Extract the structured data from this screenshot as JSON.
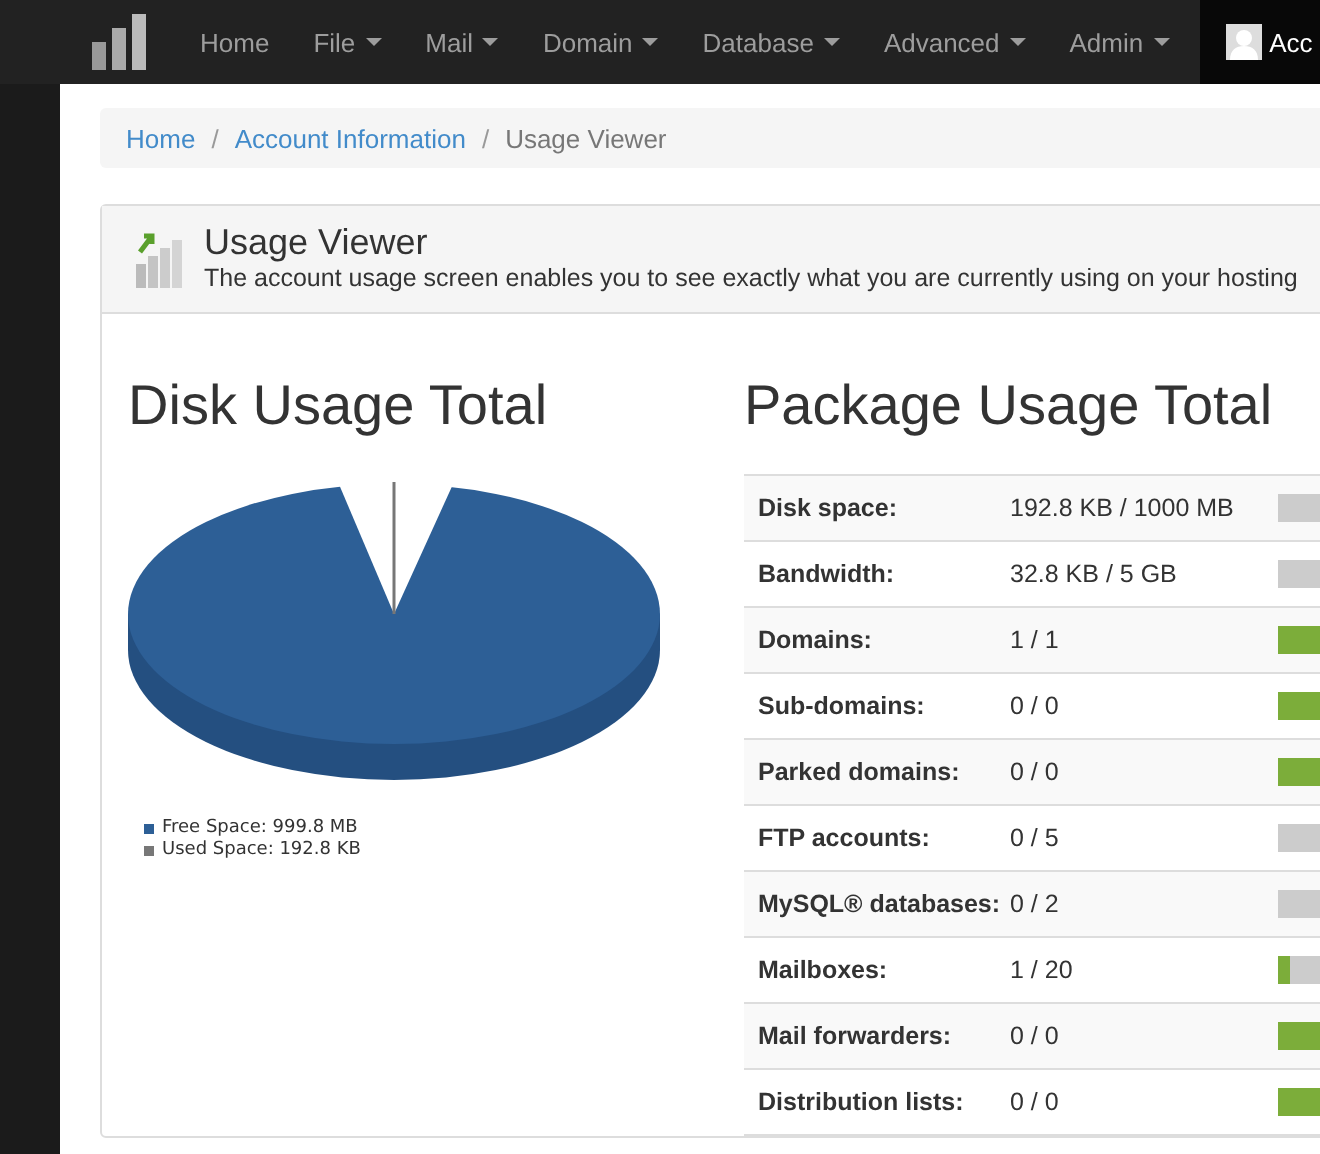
{
  "navbar": {
    "items": [
      {
        "label": "Home",
        "dropdown": false
      },
      {
        "label": "File",
        "dropdown": true
      },
      {
        "label": "Mail",
        "dropdown": true
      },
      {
        "label": "Domain",
        "dropdown": true
      },
      {
        "label": "Database",
        "dropdown": true
      },
      {
        "label": "Advanced",
        "dropdown": true
      },
      {
        "label": "Admin",
        "dropdown": true
      }
    ],
    "user": "Acc"
  },
  "breadcrumb": [
    {
      "label": "Home",
      "link": true
    },
    {
      "separator": "/",
      "label": "Account Information",
      "link": true
    },
    {
      "separator": "/",
      "label": "Usage Viewer",
      "link": false
    }
  ],
  "panel": {
    "title": "Usage Viewer",
    "description": "The account usage screen enables you to see exactly what you are currently using on your hosting"
  },
  "disk_usage": {
    "heading": "Disk Usage Total",
    "legend": [
      {
        "label": "Free Space: 999.8 MB",
        "color": "#2d5f96"
      },
      {
        "label": "Used Space: 192.8 KB",
        "color": "#777777"
      }
    ]
  },
  "package_usage": {
    "heading": "Package Usage Total",
    "rows": [
      {
        "label": "Disk space:",
        "value": "192.8 KB / 1000 MB",
        "level": 0.0002
      },
      {
        "label": "Bandwidth:",
        "value": "32.8 KB / 5 GB",
        "level": 0
      },
      {
        "label": "Domains:",
        "value": "1 / 1",
        "level": 1
      },
      {
        "label": "Sub-domains:",
        "value": "0 / 0",
        "level": 1
      },
      {
        "label": "Parked domains:",
        "value": "0 / 0",
        "level": 1
      },
      {
        "label": "FTP accounts:",
        "value": "0 / 5",
        "level": 0
      },
      {
        "label": "MySQL® databases:",
        "value": "0 / 2",
        "level": 0
      },
      {
        "label": "Mailboxes:",
        "value": "1 / 20",
        "level": 0.05
      },
      {
        "label": "Mail forwarders:",
        "value": "0 / 0",
        "level": 1
      },
      {
        "label": "Distribution lists:",
        "value": "0 / 0",
        "level": 1
      }
    ]
  }
}
